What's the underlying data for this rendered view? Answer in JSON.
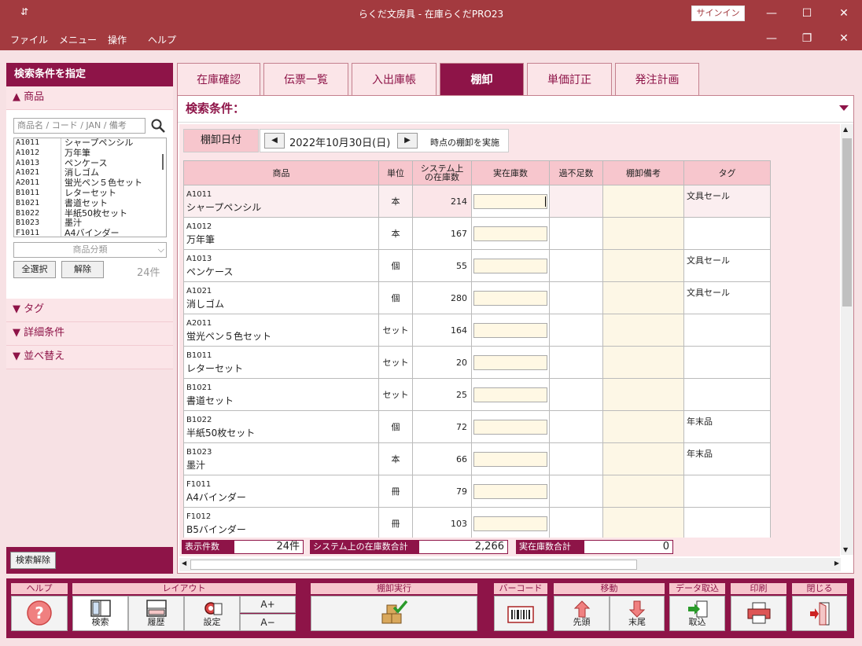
{
  "window": {
    "title": "らくだ文房具 - 在庫らくだPRO23",
    "signin": "サインイン"
  },
  "menu": [
    "ファイル",
    "メニュー",
    "操作",
    "ヘルプ"
  ],
  "left": {
    "header": "検索条件を指定",
    "section_product": "商品",
    "search_placeholder": "商品名 / コード / JAN / 備考",
    "products": [
      {
        "code": "A1011",
        "name": "シャープペンシル"
      },
      {
        "code": "A1012",
        "name": "万年筆"
      },
      {
        "code": "A1013",
        "name": "ペンケース"
      },
      {
        "code": "A1021",
        "name": "消しゴム"
      },
      {
        "code": "A2011",
        "name": "蛍光ペン５色セット"
      },
      {
        "code": "B1011",
        "name": "レターセット"
      },
      {
        "code": "B1021",
        "name": "書道セット"
      },
      {
        "code": "B1022",
        "name": "半紙50枚セット"
      },
      {
        "code": "B1023",
        "name": "墨汁"
      },
      {
        "code": "F1011",
        "name": "A4バインダー"
      }
    ],
    "category_placeholder": "商品分類",
    "select_all": "全選択",
    "deselect": "解除",
    "count": "24件",
    "section_tag": "タグ",
    "section_detail": "詳細条件",
    "section_sort": "並べ替え",
    "clear_button": "検索解除"
  },
  "tabs": [
    "在庫確認",
    "伝票一覧",
    "入出庫帳",
    "棚卸",
    "単価訂正",
    "発注計画"
  ],
  "active_tab": "棚卸",
  "condition_label": "検索条件：",
  "date": {
    "label": "棚卸日付",
    "value": "2022年10月30日(日)",
    "note": "時点の棚卸を実施"
  },
  "table": {
    "headers": {
      "product": "商品",
      "unit": "単位",
      "system_line1": "システム上",
      "system_line2": "の在庫数",
      "actual": "実在庫数",
      "diff": "過不足数",
      "memo": "棚卸備考",
      "tag": "タグ"
    },
    "rows": [
      {
        "code": "A1011",
        "name": "シャープペンシル",
        "unit": "本",
        "qty": "214",
        "tag": "文具セール"
      },
      {
        "code": "A1012",
        "name": "万年筆",
        "unit": "本",
        "qty": "167",
        "tag": ""
      },
      {
        "code": "A1013",
        "name": "ペンケース",
        "unit": "個",
        "qty": "55",
        "tag": "文具セール"
      },
      {
        "code": "A1021",
        "name": "消しゴム",
        "unit": "個",
        "qty": "280",
        "tag": "文具セール"
      },
      {
        "code": "A2011",
        "name": "蛍光ペン５色セット",
        "unit": "セット",
        "qty": "164",
        "tag": ""
      },
      {
        "code": "B1011",
        "name": "レターセット",
        "unit": "セット",
        "qty": "20",
        "tag": ""
      },
      {
        "code": "B1021",
        "name": "書道セット",
        "unit": "セット",
        "qty": "25",
        "tag": ""
      },
      {
        "code": "B1022",
        "name": "半紙50枚セット",
        "unit": "個",
        "qty": "72",
        "tag": "年末品"
      },
      {
        "code": "B1023",
        "name": "墨汁",
        "unit": "本",
        "qty": "66",
        "tag": "年末品"
      },
      {
        "code": "F1011",
        "name": "A4バインダー",
        "unit": "冊",
        "qty": "79",
        "tag": ""
      },
      {
        "code": "F1012",
        "name": "B5バインダー",
        "unit": "冊",
        "qty": "103",
        "tag": ""
      }
    ]
  },
  "summary": {
    "count_label": "表示件数",
    "count_value": "24件",
    "sys_label": "システム上の在庫数合計",
    "sys_value": "2,266",
    "actual_label": "実在庫数合計",
    "actual_value": "0"
  },
  "toolbar": {
    "help": "ヘルプ",
    "layout": "レイアウト",
    "search": "検索",
    "history": "履歴",
    "settings": "設定",
    "font_up": "A+",
    "font_down": "A−",
    "execute": "棚卸実行",
    "barcode": "バーコード",
    "move": "移動",
    "first": "先頭",
    "last": "末尾",
    "import_group": "データ取込",
    "import": "取込",
    "print": "印刷",
    "close": "閉じる"
  }
}
